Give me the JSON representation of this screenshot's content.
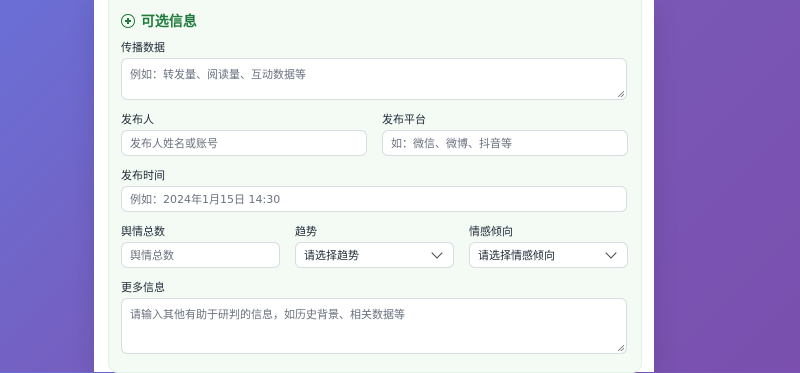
{
  "section": {
    "title": "可选信息",
    "icon": "plus-circle-icon"
  },
  "fields": {
    "spread_data": {
      "label": "传播数据",
      "placeholder": "例如：转发量、阅读量、互动数据等"
    },
    "publisher": {
      "label": "发布人",
      "placeholder": "发布人姓名或账号"
    },
    "platform": {
      "label": "发布平台",
      "placeholder": "如：微信、微博、抖音等"
    },
    "publish_time": {
      "label": "发布时间",
      "placeholder": "例如：2024年1月15日 14:30"
    },
    "sentiment_count": {
      "label": "舆情总数",
      "placeholder": "舆情总数"
    },
    "trend": {
      "label": "趋势",
      "value": "请选择趋势"
    },
    "emotion": {
      "label": "情感倾向",
      "value": "请选择情感倾向"
    },
    "more_info": {
      "label": "更多信息",
      "placeholder": "请输入其他有助于研判的信息，如历史背景、相关数据等"
    }
  }
}
